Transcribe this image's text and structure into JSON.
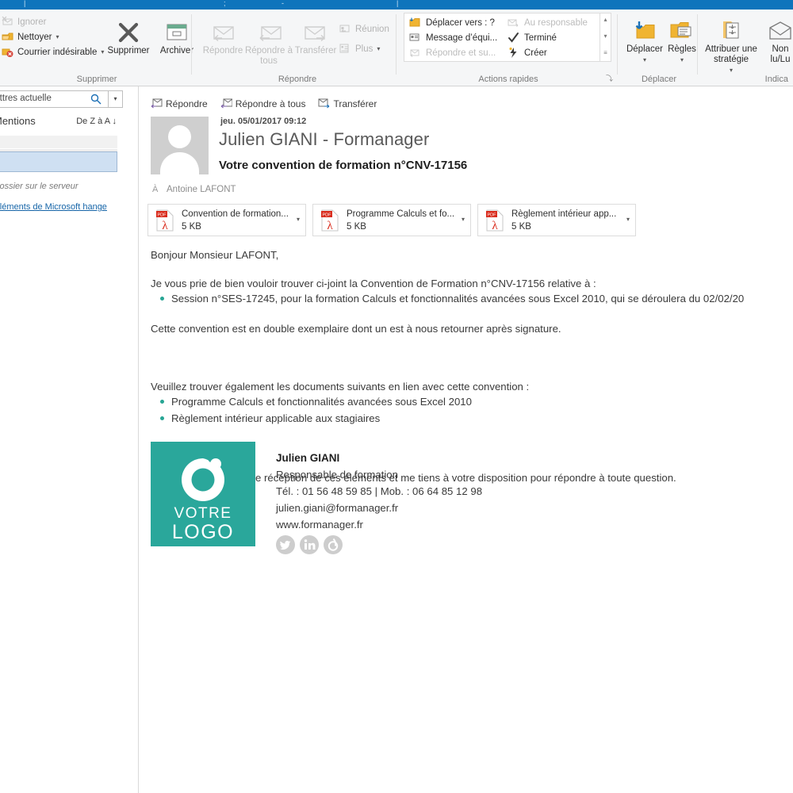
{
  "window": {
    "titlebar_color": "#0e74bc"
  },
  "ribbon": {
    "groups": [
      {
        "name": "Supprimer",
        "title": "Supprimer",
        "small_commands": [
          {
            "label": "Ignorer",
            "icon": "ignore-icon",
            "disabled": true
          },
          {
            "label": "Nettoyer",
            "icon": "cleanup-icon",
            "caret": "▾",
            "disabled": false
          },
          {
            "label": "Courrier indésirable",
            "icon": "junk-icon",
            "caret": "▾",
            "disabled": false
          }
        ],
        "big_commands": [
          {
            "label": "Supprimer",
            "icon": "delete-x-icon"
          },
          {
            "label": "Archiver",
            "icon": "archive-icon"
          }
        ]
      },
      {
        "name": "Repondre",
        "title": "Répondre",
        "big_commands": [
          {
            "label": "Répondre",
            "icon": "reply-icon",
            "disabled": true
          },
          {
            "label": "Répondre à tous",
            "icon": "reply-all-icon",
            "disabled": true
          },
          {
            "label": "Transférer",
            "icon": "forward-icon",
            "disabled": true
          }
        ],
        "small_commands": [
          {
            "label": "Réunion",
            "icon": "meeting-icon",
            "disabled": true
          },
          {
            "label": "Plus",
            "icon": "more-icon",
            "caret": "▾",
            "disabled": true
          }
        ]
      },
      {
        "name": "ActionsRapides",
        "title": "Actions rapides",
        "quick_steps": [
          {
            "label": "Déplacer vers : ?",
            "icon": "move-to-folder-icon",
            "disabled": false
          },
          {
            "label": "Au responsable",
            "icon": "to-manager-icon",
            "disabled": true
          },
          {
            "label": "Message d’équi...",
            "icon": "team-email-icon",
            "disabled": false
          },
          {
            "label": "Terminé",
            "icon": "check-icon",
            "disabled": false
          },
          {
            "label": "Répondre et su...",
            "icon": "reply-delete-icon",
            "disabled": true
          },
          {
            "label": "Créer",
            "icon": "new-quickstep-icon",
            "disabled": false
          }
        ],
        "scroll_up": "▴",
        "scroll_down": "▾",
        "scroll_more": "≡",
        "dialog_launcher": "⤵"
      },
      {
        "name": "Deplacer",
        "title": "Déplacer",
        "big_commands": [
          {
            "label": "Déplacer",
            "icon": "move-icon",
            "caret": "▾"
          },
          {
            "label": "Règles",
            "icon": "rules-icon",
            "caret": "▾"
          }
        ]
      },
      {
        "name": "Indicateurs",
        "title": "Indica",
        "big_commands": [
          {
            "label": "Attribuer une stratégie",
            "icon": "assign-policy-icon",
            "caret": "▾"
          },
          {
            "label": "Non lu/Lu",
            "icon": "unread-read-icon"
          }
        ]
      }
    ]
  },
  "left_pane": {
    "search": {
      "value": "aux lettres actuelle",
      "magnifier_icon": "search-icon",
      "dropdown_caret": "▾"
    },
    "filter_label": "Mentions",
    "sort_label": "De Z à A",
    "sort_arrow": "↓",
    "server_note": "ns ce dossier sur le serveur",
    "server_link": "lus d’éléments de Microsoft hange"
  },
  "reading_pane": {
    "actions": [
      {
        "label": "Répondre",
        "icon": "reply-icon"
      },
      {
        "label": "Répondre à tous",
        "icon": "reply-all-icon"
      },
      {
        "label": "Transférer",
        "icon": "forward-icon"
      }
    ],
    "date": "jeu. 05/01/2017 09:12",
    "from": "Julien GIANI - Formanager",
    "subject": "Votre convention de formation n°CNV-17156",
    "to_icon": "À",
    "to": "Antoine LAFONT",
    "attachments": [
      {
        "name": "Convention de formation...",
        "size": "5 KB",
        "type": "PDF",
        "caret": "▾"
      },
      {
        "name": "Programme Calculs et fo...",
        "size": "5 KB",
        "type": "PDF",
        "caret": "▾"
      },
      {
        "name": "Règlement intérieur app...",
        "size": "5 KB",
        "type": "PDF",
        "caret": "▾"
      }
    ],
    "body": {
      "greeting": "Bonjour Monsieur LAFONT,",
      "para1": "Je vous prie de bien vouloir trouver ci-joint la Convention de Formation n°CNV-17156 relative à :",
      "list1": [
        "Session n°SES-17245, pour la formation Calculs et fonctionnalités avancées sous Excel 2010, qui se déroulera du 02/02/20"
      ],
      "para2": "Cette convention est en double exemplaire dont un est à nous retourner après signature.",
      "para3": "Veuillez trouver également les documents suivants en lien avec cette convention :",
      "list2": [
        "Programme Calculs et fonctionnalités avancées sous Excel 2010",
        "Règlement intérieur applicable aux stagiaires"
      ],
      "para4": "Je vous souhaite bonne réception de ces éléments et me tiens à votre disposition pour répondre à toute question."
    },
    "signature": {
      "logo": {
        "line1": "VOTRE",
        "line2": "LOGO",
        "color": "#2aa79b"
      },
      "name": "Julien GIANI",
      "role": "Responsable de formation",
      "phones": "Tél. : 01 56 48 59 85 | Mob. : 06 64 85 12 98",
      "email": "julien.giani@formanager.fr",
      "website": "www.formanager.fr",
      "socials": [
        {
          "icon": "twitter-icon"
        },
        {
          "icon": "linkedin-icon"
        },
        {
          "icon": "viadeo-icon"
        }
      ]
    }
  }
}
